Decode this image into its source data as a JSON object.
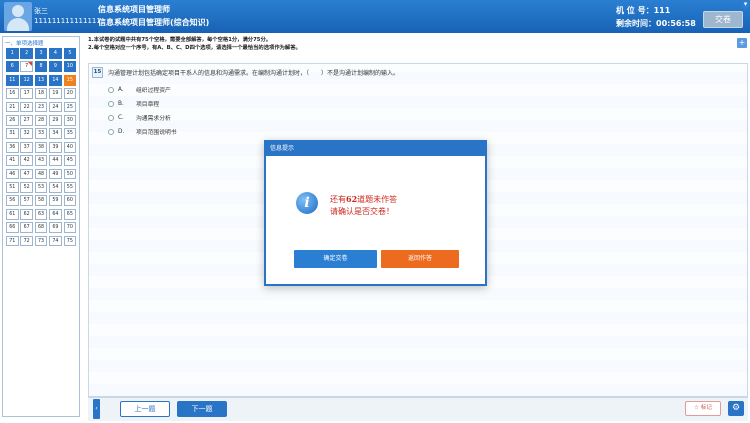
{
  "header": {
    "user_name": "张三",
    "user_id": "111111111111111",
    "exam_title": "信息系统项目管理师",
    "exam_subtitle": "信息系统项目管理师(综合知识)",
    "seat_label": "机 位 号：111",
    "timer_label": "剩余时间：00:56:58",
    "submit_label": "交卷"
  },
  "instructions": {
    "line1": "1.本试卷的试题中共有75个空格，需要全部解答，每个空格1分，满分75分。",
    "line2": "2.每个空格对应一个序号，有A、B、C、D四个选项，请选择一个最恰当的选项作为解答。",
    "plus_symbol": "+"
  },
  "left_panel": {
    "section_title": "一、单项选择题",
    "questions": [
      1,
      2,
      3,
      4,
      5,
      6,
      7,
      8,
      9,
      10,
      11,
      12,
      13,
      14,
      15,
      16,
      17,
      18,
      19,
      20,
      21,
      22,
      23,
      24,
      25,
      26,
      27,
      28,
      29,
      30,
      31,
      32,
      33,
      34,
      35,
      36,
      37,
      38,
      39,
      40,
      41,
      42,
      43,
      44,
      45,
      46,
      47,
      48,
      49,
      50,
      51,
      52,
      53,
      54,
      55,
      56,
      57,
      58,
      59,
      60,
      61,
      62,
      63,
      64,
      65,
      66,
      67,
      68,
      69,
      70,
      71,
      72,
      73,
      74,
      75
    ],
    "answered": [
      1,
      2,
      3,
      4,
      5,
      6,
      8,
      9,
      10,
      11,
      12,
      13,
      14
    ],
    "marked": [
      7
    ],
    "current": 15
  },
  "question": {
    "number": "15",
    "text": "沟通管理计划包括确定项目干系人的信息和沟通需求。在编制沟通计划时，（　　）不是沟通计划编制的输入。",
    "options": [
      {
        "letter": "A.",
        "text": "组织过程资产"
      },
      {
        "letter": "B.",
        "text": "项目章程"
      },
      {
        "letter": "C.",
        "text": "沟通需求分析"
      },
      {
        "letter": "D.",
        "text": "项目范围说明书"
      }
    ]
  },
  "bottom": {
    "side_tab": "‹",
    "prev_label": "上一题",
    "next_label": "下一题",
    "mark_label": "☆ 标记",
    "settings_icon": "⚙"
  },
  "modal": {
    "title": "信息提示",
    "msg_prefix": "还有",
    "msg_count": "62",
    "msg_suffix": "道题未作答",
    "msg_line2": "请确认是否交卷！",
    "confirm_label": "确定交卷",
    "return_label": "返回作答"
  },
  "colors": {
    "accent": "#2a74c7",
    "current": "#f0821e",
    "return_button": "#ec6b1f",
    "warning_text": "#d0261b"
  }
}
